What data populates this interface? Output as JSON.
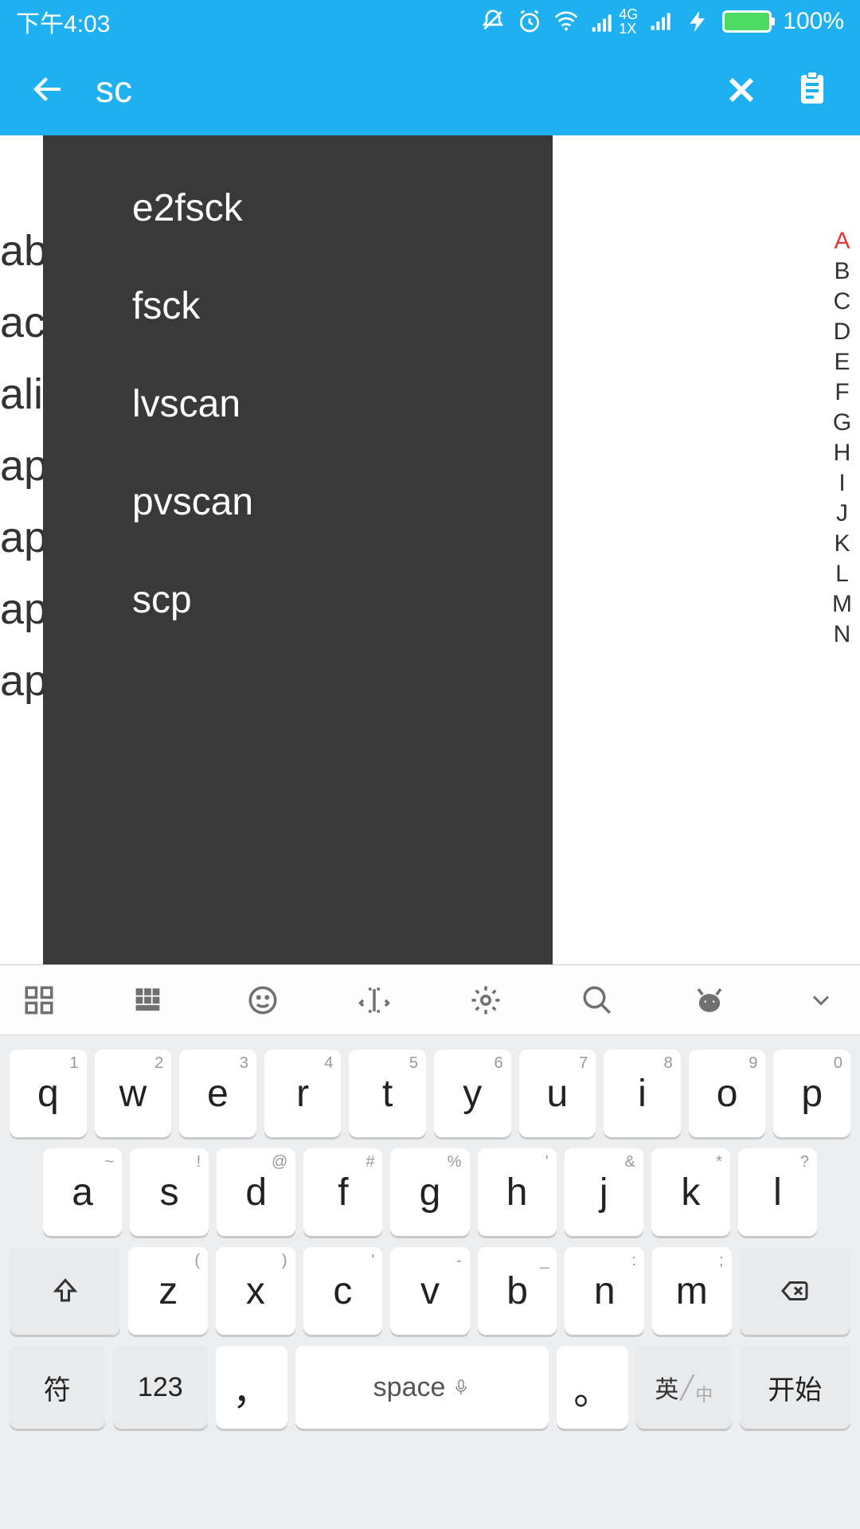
{
  "status": {
    "time": "下午4:03",
    "network_small": "4G",
    "network_sub": "1X",
    "battery_pct": "100%"
  },
  "appbar": {
    "search_value": "sc"
  },
  "dropdown": {
    "items": [
      "e2fsck",
      "fsck",
      "lvscan",
      "pvscan",
      "scp"
    ]
  },
  "bg_list": [
    "ab",
    "ac",
    "ali",
    "ap",
    "ap",
    "ap",
    "ap"
  ],
  "alpha": [
    "A",
    "B",
    "C",
    "D",
    "E",
    "F",
    "G",
    "H",
    "I",
    "J",
    "K",
    "L",
    "M",
    "N"
  ],
  "alpha_active": "A",
  "keyboard": {
    "row1": [
      {
        "sup": "1",
        "main": "q"
      },
      {
        "sup": "2",
        "main": "w"
      },
      {
        "sup": "3",
        "main": "e"
      },
      {
        "sup": "4",
        "main": "r"
      },
      {
        "sup": "5",
        "main": "t"
      },
      {
        "sup": "6",
        "main": "y"
      },
      {
        "sup": "7",
        "main": "u"
      },
      {
        "sup": "8",
        "main": "i"
      },
      {
        "sup": "9",
        "main": "o"
      },
      {
        "sup": "0",
        "main": "p"
      }
    ],
    "row2": [
      {
        "sup": "~",
        "main": "a"
      },
      {
        "sup": "!",
        "main": "s"
      },
      {
        "sup": "@",
        "main": "d"
      },
      {
        "sup": "#",
        "main": "f"
      },
      {
        "sup": "%",
        "main": "g"
      },
      {
        "sup": "'",
        "main": "h"
      },
      {
        "sup": "&",
        "main": "j"
      },
      {
        "sup": "*",
        "main": "k"
      },
      {
        "sup": "?",
        "main": "l"
      }
    ],
    "row3": [
      {
        "sup": "(",
        "main": "z"
      },
      {
        "sup": ")",
        "main": "x"
      },
      {
        "sup": "'",
        "main": "c"
      },
      {
        "sup": "-",
        "main": "v"
      },
      {
        "sup": "_",
        "main": "b"
      },
      {
        "sup": ":",
        "main": "n"
      },
      {
        "sup": ";",
        "main": "m"
      }
    ],
    "sym": "符",
    "num": "123",
    "comma": "，",
    "space": "space",
    "dot": "。",
    "lang_top": "英",
    "lang_bot": "中",
    "start": "开始"
  }
}
